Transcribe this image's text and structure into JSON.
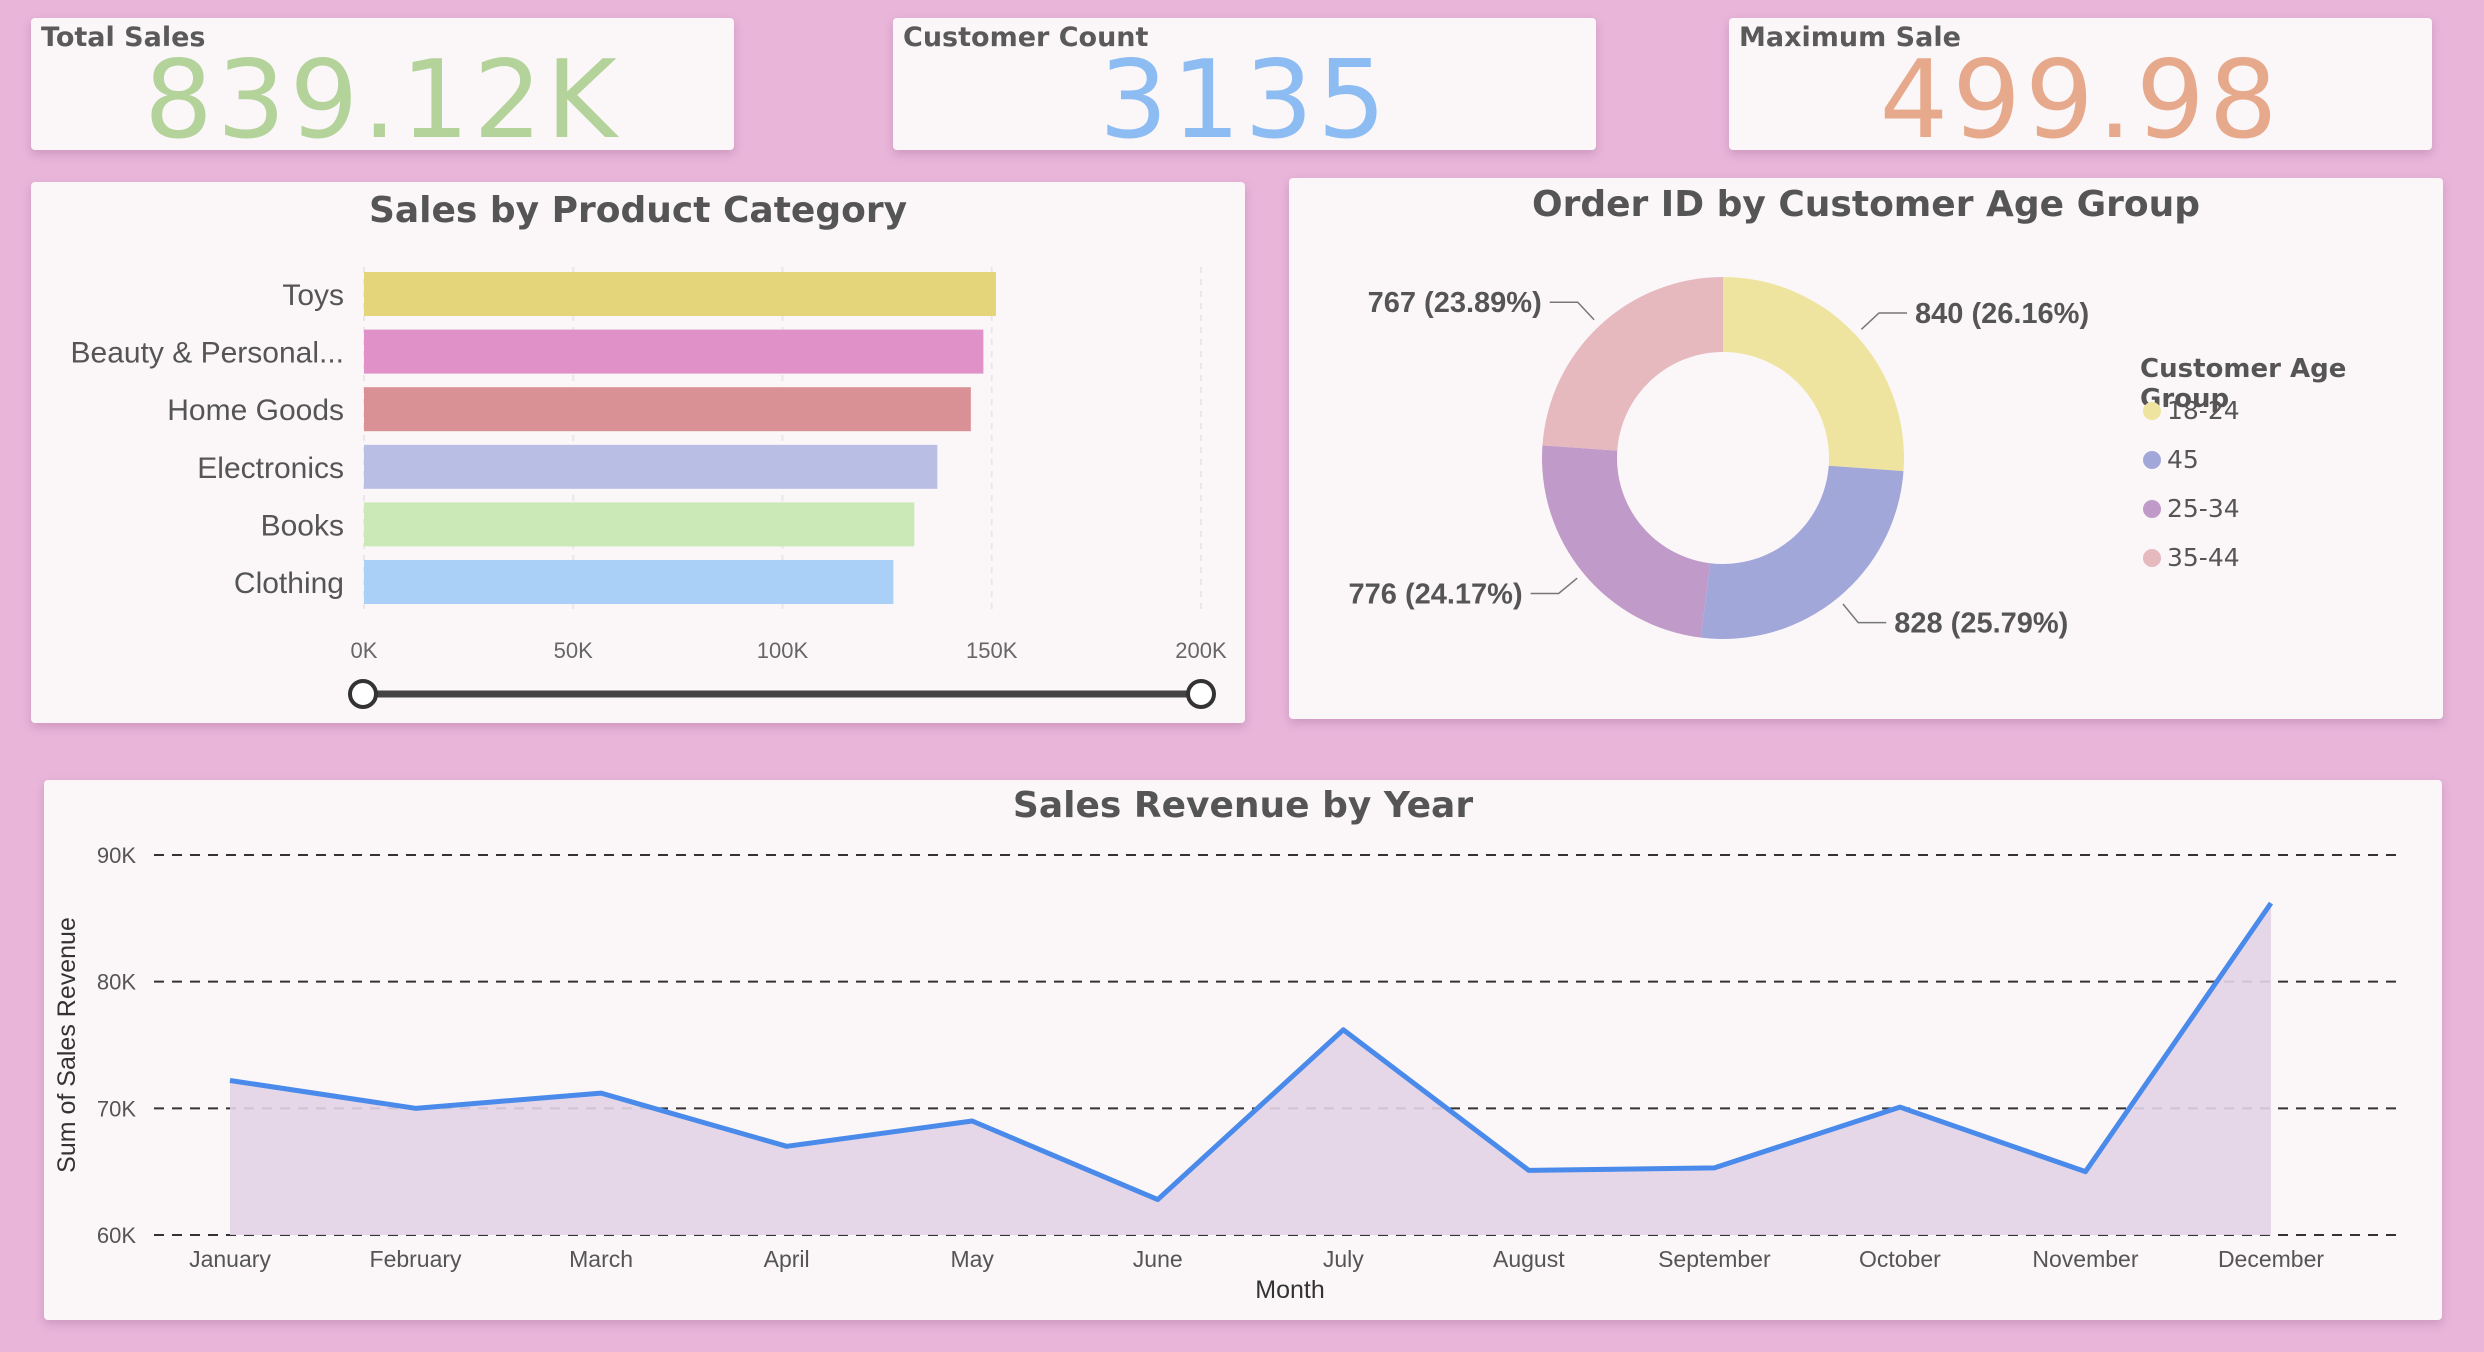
{
  "kpis": [
    {
      "title": "Total Sales",
      "value": "839.12K",
      "color": "#b3d39a"
    },
    {
      "title": "Customer Count",
      "value": "3135",
      "color": "#8cbcf2"
    },
    {
      "title": "Maximum Sale",
      "value": "499.98",
      "color": "#e7a98b"
    }
  ],
  "colors": {
    "background": "#e9b6da",
    "card": "#fbf7f9",
    "line": "#4a8aea",
    "area": "#e2d3e6"
  },
  "chart_data": [
    {
      "type": "bar",
      "orientation": "horizontal",
      "title": "Sales by Product Category",
      "categories": [
        "Toys",
        "Beauty & Personal...",
        "Home Goods",
        "Electronics",
        "Books",
        "Clothing"
      ],
      "values": [
        151000,
        148000,
        145000,
        137000,
        131500,
        126500
      ],
      "colors": [
        "#e4d47a",
        "#e091c8",
        "#d99196",
        "#b8bee4",
        "#cbe9b6",
        "#abd0f7"
      ],
      "xlim": [
        0,
        200000
      ],
      "xticks": [
        "0K",
        "50K",
        "100K",
        "150K",
        "200K"
      ],
      "grid": true
    },
    {
      "type": "pie",
      "variant": "donut",
      "title": "Order ID by Customer Age Group",
      "legend_title": "Customer Age Group",
      "legend_position": "right",
      "slices": [
        {
          "label": "18-24",
          "value": 840,
          "text": "840 (26.16%)",
          "color": "#eee49f"
        },
        {
          "label": "45",
          "value": 828,
          "text": "828 (25.79%)",
          "color": "#a2a7da"
        },
        {
          "label": "25-34",
          "value": 776,
          "text": "776 (24.17%)",
          "color": "#c09ac8"
        },
        {
          "label": "35-44",
          "value": 767,
          "text": "767 (23.89%)",
          "color": "#e6b9bf"
        }
      ]
    },
    {
      "type": "area",
      "title": "Sales Revenue by Year",
      "xlabel": "Month",
      "ylabel": "Sum of Sales Revenue",
      "categories": [
        "January",
        "February",
        "March",
        "April",
        "May",
        "June",
        "July",
        "August",
        "September",
        "October",
        "November",
        "December"
      ],
      "values": [
        72200,
        70000,
        71200,
        67000,
        69000,
        62800,
        76200,
        65100,
        65300,
        70100,
        65000,
        86200
      ],
      "ylim": [
        60000,
        90000
      ],
      "yticks": [
        "60K",
        "70K",
        "80K",
        "90K"
      ],
      "grid": true
    }
  ]
}
